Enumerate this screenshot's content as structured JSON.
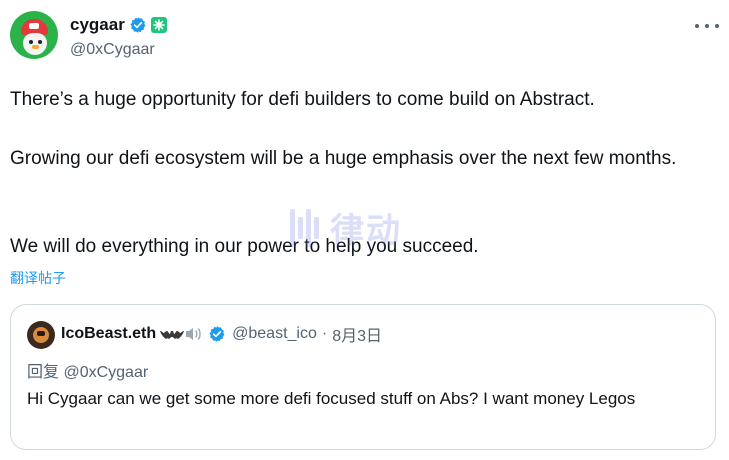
{
  "author": {
    "display_name": "cygaar",
    "handle": "@0xCygaar",
    "verified": true,
    "affiliate_badge_color": "#1ec67d"
  },
  "menu_icon": "more-horizontal-icon",
  "body": [
    "There’s a huge opportunity for defi builders to come build on Abstract.",
    "Growing our defi ecosystem will be a huge emphasis over the next few months.",
    "We will do everything in our power to help you succeed."
  ],
  "translate_label": "翻译帖子",
  "watermark_text": "律动",
  "quote": {
    "display_name": "IcoBeast.eth",
    "emoji": [
      "bat-icon",
      "speaker-icon"
    ],
    "verified": true,
    "handle": "@beast_ico",
    "separator": "·",
    "date": "8月3日",
    "reply_to": "回复 @0xCygaar",
    "text": "Hi Cygaar can we get some more defi focused stuff on Abs? I want money Legos"
  },
  "colors": {
    "text": "#0f1419",
    "secondary": "#536471",
    "link": "#1d9bf0",
    "border": "#cfd9de",
    "verified": "#1d9bf0"
  }
}
